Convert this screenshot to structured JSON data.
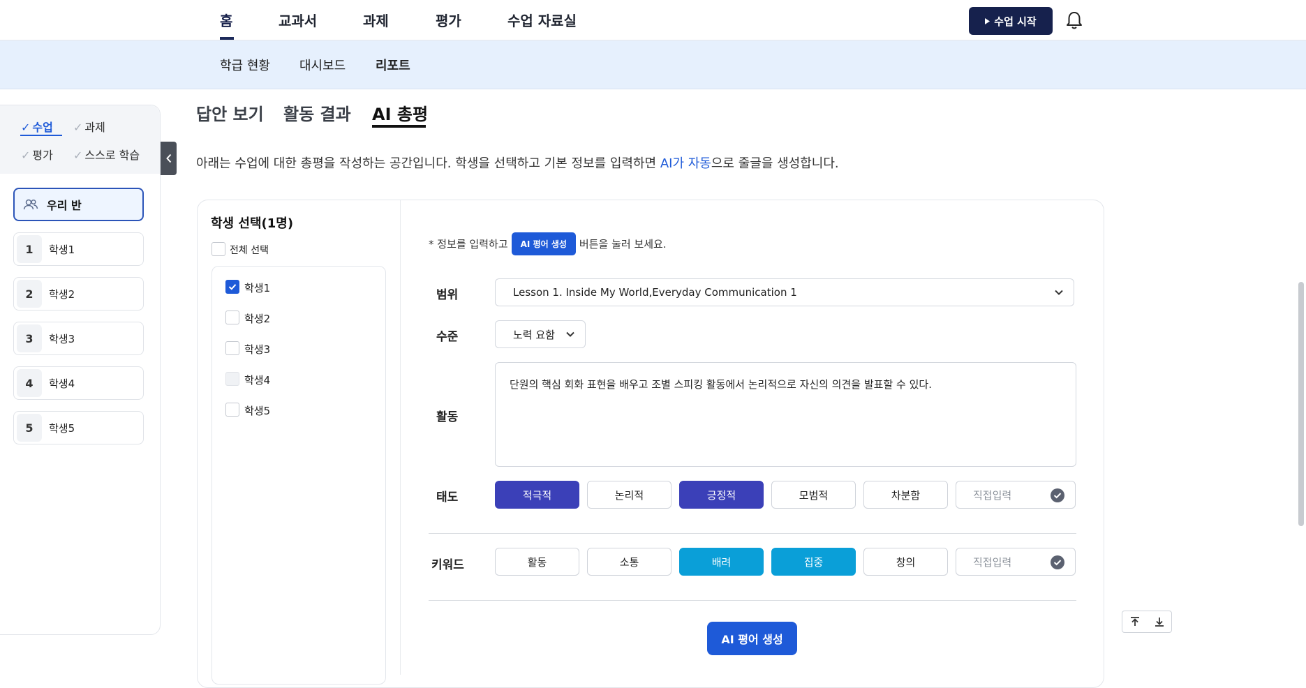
{
  "top_nav": {
    "items": [
      "홈",
      "교과서",
      "과제",
      "평가",
      "수업 자료실"
    ],
    "start_button": "수업 시작"
  },
  "sub_nav": {
    "items": [
      "학급 현황",
      "대시보드",
      "리포트"
    ]
  },
  "sidebar": {
    "filters": [
      "수업",
      "과제",
      "평가",
      "스스로 학습"
    ],
    "class_label": "우리 반",
    "students": [
      {
        "num": "1",
        "name": "학생1"
      },
      {
        "num": "2",
        "name": "학생2"
      },
      {
        "num": "3",
        "name": "학생3"
      },
      {
        "num": "4",
        "name": "학생4"
      },
      {
        "num": "5",
        "name": "학생5"
      }
    ]
  },
  "content_tabs": [
    "답안 보기",
    "활동 결과",
    "AI 총평"
  ],
  "description": {
    "before": "아래는 수업에 대한 총평을 작성하는 공간입니다. 학생을 선택하고 기본 정보를 입력하면 ",
    "highlight": "AI가 자동",
    "after": "으로 줄글을 생성합니다."
  },
  "student_select": {
    "title": "학생 선택(1명)",
    "select_all": "전체 선택",
    "students": [
      {
        "name": "학생1",
        "checked": true
      },
      {
        "name": "학생2",
        "checked": false
      },
      {
        "name": "학생3",
        "checked": false
      },
      {
        "name": "학생4",
        "checked": false,
        "disabled": true
      },
      {
        "name": "학생5",
        "checked": false
      }
    ]
  },
  "form": {
    "hint_before": "* 정보를 입력하고",
    "hint_chip": "AI 평어 생성",
    "hint_after": "버튼을 눌러 보세요.",
    "range_label": "범위",
    "range_value": "Lesson 1. Inside My World,Everyday Communication 1",
    "level_label": "수준",
    "level_value": "노력 요함",
    "activity_label": "활동",
    "activity_value": "단원의 핵심 회화 표현을 배우고 조별 스피킹 활동에서 논리적으로 자신의 의견을 발표할 수 있다.",
    "attitude_label": "태도",
    "attitude_options": [
      "적극적",
      "논리적",
      "긍정적",
      "모범적",
      "차분함"
    ],
    "attitude_selected": [
      "적극적",
      "긍정적"
    ],
    "keyword_label": "키워드",
    "keyword_options": [
      "활동",
      "소통",
      "배려",
      "집중",
      "창의"
    ],
    "keyword_selected": [
      "배려",
      "집중"
    ],
    "direct_input_placeholder": "직접입력",
    "generate_button": "AI 평어 생성"
  },
  "colors": {
    "primary": "#1e5ad8",
    "navy": "#16214d",
    "attitude_selected": "#3b40b8",
    "keyword_selected": "#0a9fd8",
    "subnav_bg": "#e6f0fd"
  },
  "icons": [
    "play-icon",
    "bell-icon",
    "users-icon",
    "chevron-left-icon",
    "chevron-down-icon",
    "check-icon",
    "check-circle-icon",
    "scroll-top-icon",
    "scroll-bottom-icon"
  ]
}
